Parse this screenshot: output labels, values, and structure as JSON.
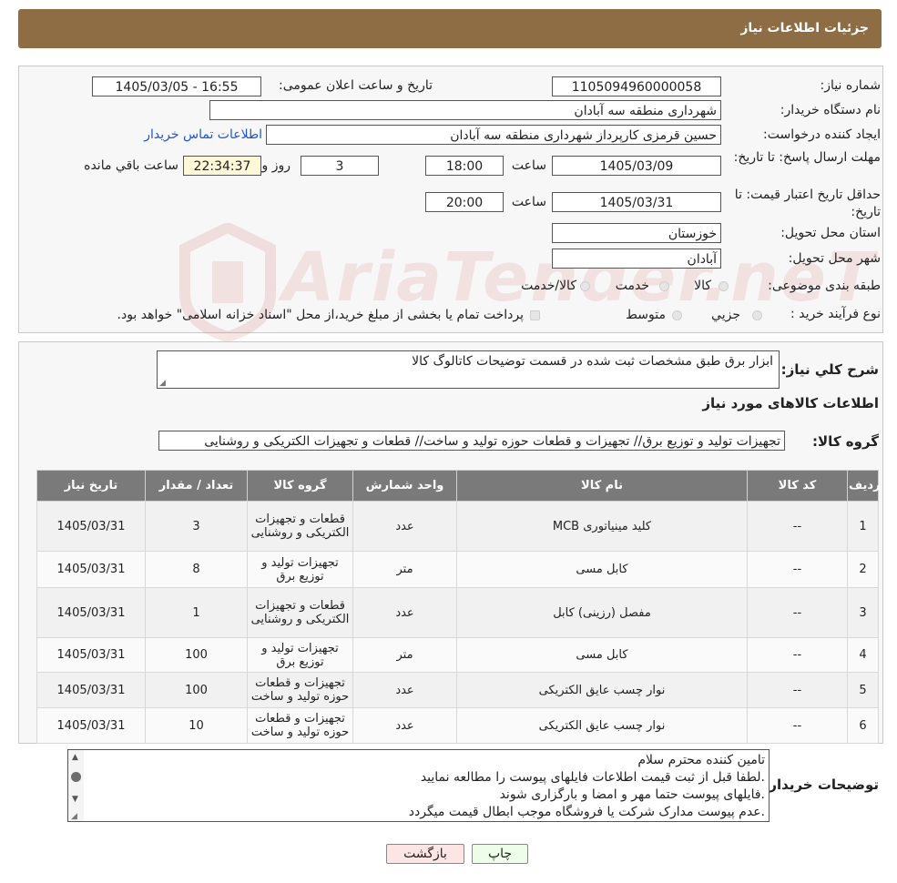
{
  "header": {
    "title": "جزئیات اطلاعات نیاز"
  },
  "watermark": "AriaTender.neT",
  "info": {
    "need_number_label": "شماره نیاز:",
    "need_number": "1105094960000058",
    "announce_label": "تاریخ و ساعت اعلان عمومی:",
    "announce_value": "1405/03/05 - 16:55",
    "buyer_org_label": "نام دستگاه خریدار:",
    "buyer_org": "شهرداری منطقه سه آبادان",
    "creator_label": "ایجاد کننده درخواست:",
    "creator": "حسین قرمزی کارپرداز شهرداری منطقه سه آبادان",
    "contact_link": "اطلاعات تماس خریدار",
    "deadline_label": "مهلت ارسال پاسخ: تا تاریخ:",
    "deadline_date": "1405/03/09",
    "time_label": "ساعت",
    "deadline_time": "18:00",
    "days": "3",
    "days_label": "روز و",
    "remaining": "22:34:37",
    "remaining_label": "ساعت باقي مانده",
    "validity_label": "حداقل تاریخ اعتبار قیمت: تا تاریخ:",
    "validity_date": "1405/03/31",
    "validity_time": "20:00",
    "province_label": "استان محل تحویل:",
    "province": "خوزستان",
    "city_label": "شهر محل تحویل:",
    "city": "آبادان",
    "category_label": "طبقه بندی موضوعی:",
    "category_options": [
      "کالا",
      "خدمت",
      "کالا/خدمت"
    ],
    "process_label": "نوع فرآیند خرید :",
    "process_options": [
      "جزیي",
      "متوسط"
    ],
    "process_note": "پرداخت تمام یا بخشی از مبلغ خرید،از محل \"اسناد خزانه اسلامی\" خواهد بود."
  },
  "summary": {
    "label": "شرح کلي نیاز:",
    "text": "ابزار برق طبق مشخصات ثبت شده در قسمت توضیحات کاتالوگ کالا",
    "items_title": "اطلاعات کالاهای مورد نیاز",
    "group_label": "گروه کالا:",
    "group_value": "تجهیزات تولید و توزیع برق// تجهیزات و قطعات حوزه تولید و ساخت// قطعات و تجهیزات الکتریکی و روشنایی"
  },
  "table": {
    "headers": [
      "ردیف",
      "کد کالا",
      "نام کالا",
      "واحد شمارش",
      "گروه کالا",
      "تعداد / مقدار",
      "تاریخ نیاز"
    ],
    "rows": [
      {
        "idx": "1",
        "code": "--",
        "name": "کلید مینیاتوری MCB",
        "unit": "عدد",
        "group": "قطعات و تجهیزات الکتریکی و روشنایی",
        "qty": "3",
        "date": "1405/03/31"
      },
      {
        "idx": "2",
        "code": "--",
        "name": "کابل مسی",
        "unit": "متر",
        "group": "تجهیزات تولید و توزیع برق",
        "qty": "8",
        "date": "1405/03/31"
      },
      {
        "idx": "3",
        "code": "--",
        "name": "مفصل (رزینی) کابل",
        "unit": "عدد",
        "group": "قطعات و تجهیزات الکتریکی و روشنایی",
        "qty": "1",
        "date": "1405/03/31"
      },
      {
        "idx": "4",
        "code": "--",
        "name": "کابل مسی",
        "unit": "متر",
        "group": "تجهیزات تولید و توزیع برق",
        "qty": "100",
        "date": "1405/03/31"
      },
      {
        "idx": "5",
        "code": "--",
        "name": "نوار چسب عایق الکتریکی",
        "unit": "عدد",
        "group": "تجهیزات و قطعات حوزه تولید و ساخت",
        "qty": "100",
        "date": "1405/03/31"
      },
      {
        "idx": "6",
        "code": "--",
        "name": "نوار چسب عایق الکتریکی",
        "unit": "عدد",
        "group": "تجهیزات و قطعات حوزه تولید و ساخت",
        "qty": "10",
        "date": "1405/03/31"
      }
    ]
  },
  "notes": {
    "label": "توضیحات خریدار:",
    "lines": [
      "تامین کننده محترم سلام",
      ".لطفا قبل از ثبت قیمت اطلاعات فایلهای پیوست را مطالعه نمایید",
      ".فایلهای پیوست حتما مهر و امضا و بارگزاری شوند",
      ".عدم پیوست مدارک شرکت یا فروشگاه موجب ابطال قیمت میگردد"
    ]
  },
  "buttons": {
    "print": "چاپ",
    "back": "بازگشت"
  },
  "colors": {
    "header": "#8e6c44",
    "table_header": "#7a7a7a",
    "print_button": "#eefde8",
    "back_button": "#fde5e5"
  }
}
